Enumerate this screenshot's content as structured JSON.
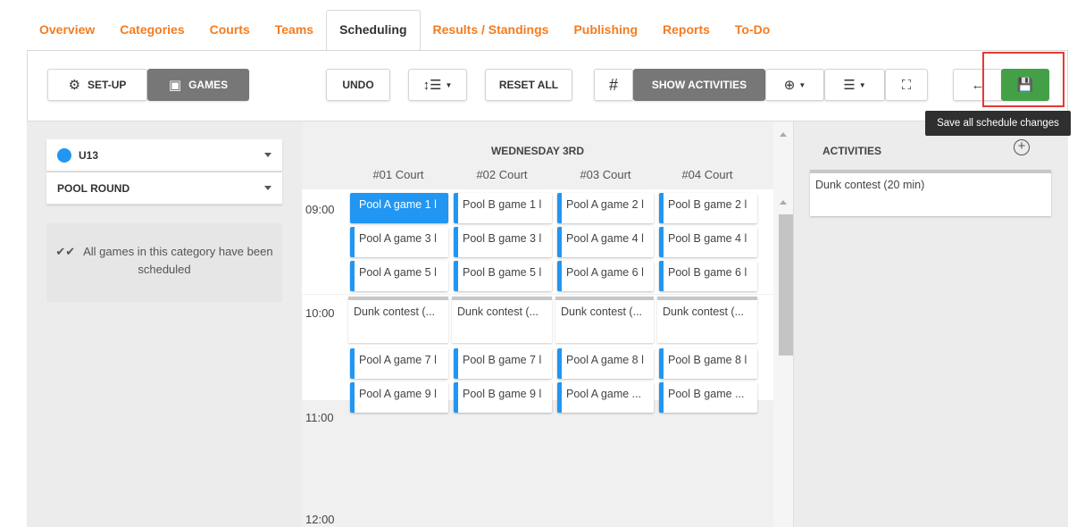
{
  "tabs": [
    "Overview",
    "Categories",
    "Courts",
    "Teams",
    "Scheduling",
    "Results / Standings",
    "Publishing",
    "Reports",
    "To-Do"
  ],
  "active_tab": "Scheduling",
  "toolbar": {
    "setup_label": "SET-UP",
    "games_label": "GAMES",
    "undo_label": "UNDO",
    "reset_label": "RESET ALL",
    "hash_label": "#",
    "show_activities_label": "SHOW ACTIVITIES",
    "save_tooltip": "Save all schedule changes"
  },
  "left": {
    "category": "U13",
    "round": "POOL ROUND",
    "info": "All games in this category have been scheduled"
  },
  "schedule": {
    "day": "WEDNESDAY 3RD",
    "courts": [
      "#01 Court",
      "#02 Court",
      "#03 Court",
      "#04 Court"
    ],
    "times": [
      "09:00",
      "10:00",
      "11:00",
      "12:00"
    ],
    "rows": [
      [
        "Pool A game 1 l",
        "Pool B game 1 l",
        "Pool A game 2 l",
        "Pool B game 2 l"
      ],
      [
        "Pool A game 3 l",
        "Pool B game 3 l",
        "Pool A game 4 l",
        "Pool B game 4 l"
      ],
      [
        "Pool A game 5 l",
        "Pool B game 5 l",
        "Pool A game 6 l",
        "Pool B game 6 l"
      ],
      [
        "Dunk contest (...",
        "Dunk contest (...",
        "Dunk contest (...",
        "Dunk contest (..."
      ],
      [
        "Pool A game 7 l",
        "Pool B game 7 l",
        "Pool A game 8 l",
        "Pool B game 8 l"
      ],
      [
        "Pool A game 9 l",
        "Pool B game 9 l",
        "Pool A game ...",
        "Pool B game ..."
      ]
    ]
  },
  "activities": {
    "title": "ACTIVITIES",
    "items": [
      "Dunk contest (20 min)"
    ]
  },
  "colors": {
    "tab_accent": "#f47c20",
    "game_accent": "#2196f3",
    "save_green": "#43a047",
    "highlight_red": "#e53935"
  }
}
